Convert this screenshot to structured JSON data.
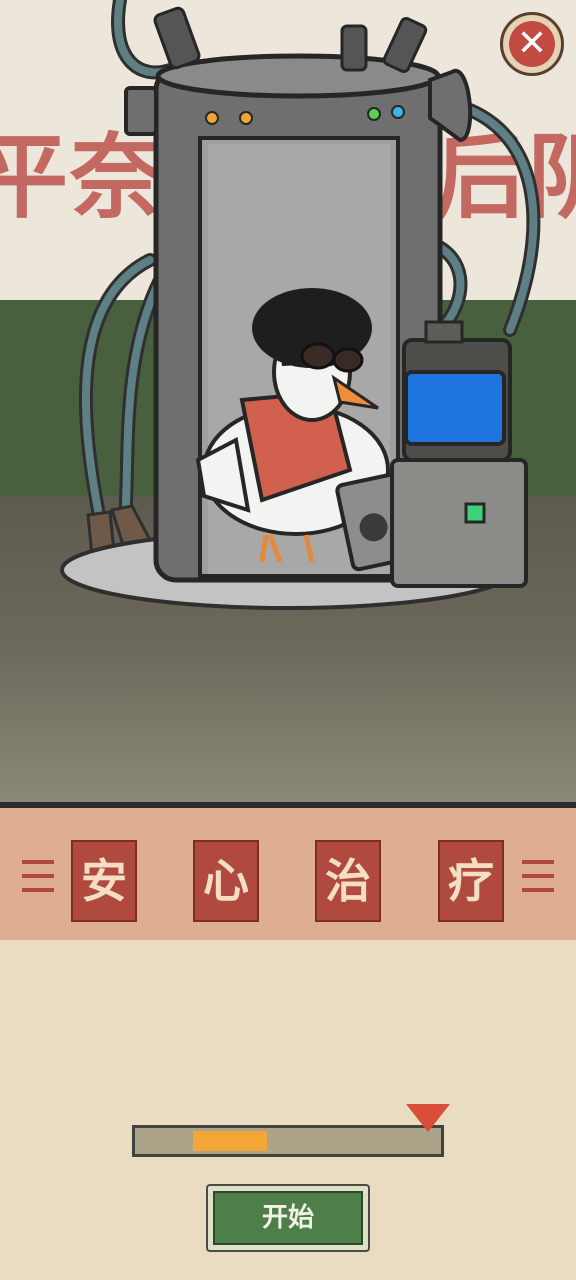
{
  "scene": {
    "wall_text_left": "平奈",
    "wall_text_right": "后阴",
    "character": "chicken-in-afro-with-sunglasses",
    "device": "teleporter-capsule"
  },
  "close_button": {
    "icon": "close-icon",
    "label": "✕"
  },
  "title": {
    "chars": [
      "安",
      "心",
      "治",
      "疗"
    ],
    "tile_color": "#b04a3f",
    "text_color": "#f4dfc4"
  },
  "progress": {
    "fill_start": 0.18,
    "fill_end": 0.42,
    "pointer_position": 0.95,
    "fill_color": "#f3a737",
    "pointer_color": "#d94e3b"
  },
  "start_button": {
    "label": "开始",
    "color": "#4f7f48"
  }
}
